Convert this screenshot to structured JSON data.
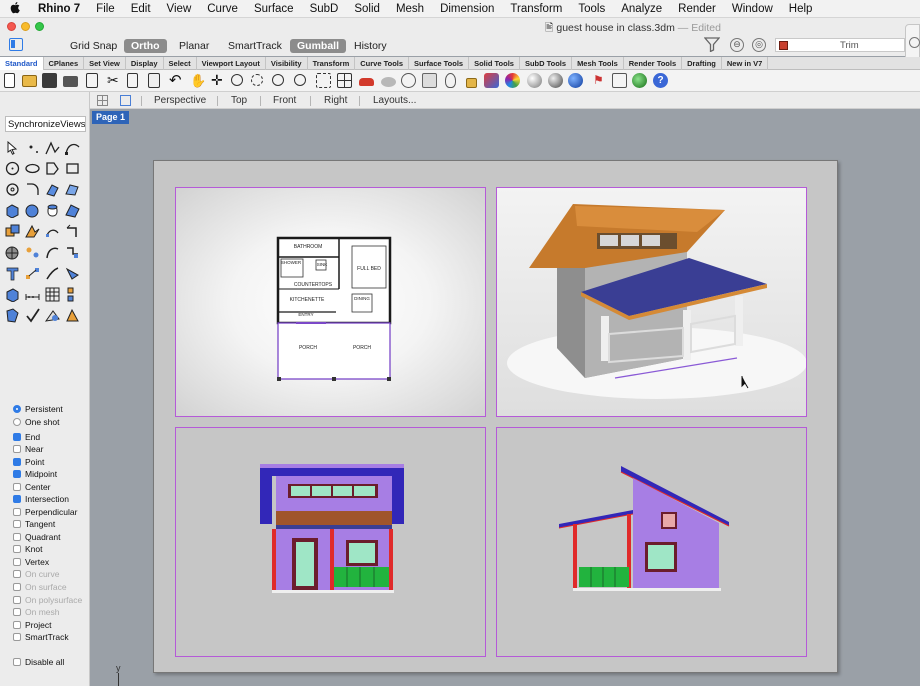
{
  "menu": {
    "apple": "",
    "app": "Rhino 7",
    "items": [
      "File",
      "Edit",
      "View",
      "Curve",
      "Surface",
      "SubD",
      "Solid",
      "Mesh",
      "Dimension",
      "Transform",
      "Tools",
      "Analyze",
      "Render",
      "Window",
      "Help"
    ]
  },
  "window": {
    "title": "guest house in class.3dm",
    "status": "— Edited"
  },
  "status_bar": {
    "items": [
      {
        "label": "Grid Snap",
        "on": false
      },
      {
        "label": "Ortho",
        "on": true
      },
      {
        "label": "Planar",
        "on": false
      },
      {
        "label": "SmartTrack",
        "on": false
      },
      {
        "label": "Gumball",
        "on": true
      },
      {
        "label": "History",
        "on": false
      }
    ],
    "layer": "Trim",
    "layer_color": "#c8402e"
  },
  "tabs": [
    "Standard",
    "CPlanes",
    "Set View",
    "Display",
    "Select",
    "Viewport Layout",
    "Visibility",
    "Transform",
    "Curve Tools",
    "Surface Tools",
    "Solid Tools",
    "SubD Tools",
    "Mesh Tools",
    "Render Tools",
    "Drafting",
    "New in V7"
  ],
  "active_tab": "Standard",
  "viewport_tabs": [
    "Perspective",
    "Top",
    "Front",
    "Right",
    "Layouts..."
  ],
  "command": {
    "value": "SynchronizeViews"
  },
  "page_tab": "Page 1",
  "osnap": {
    "mode": [
      {
        "label": "Persistent",
        "selected": true
      },
      {
        "label": "One shot",
        "selected": false
      }
    ],
    "items": [
      {
        "label": "End",
        "checked": true,
        "enabled": true
      },
      {
        "label": "Near",
        "checked": false,
        "enabled": true
      },
      {
        "label": "Point",
        "checked": true,
        "enabled": true
      },
      {
        "label": "Midpoint",
        "checked": true,
        "enabled": true
      },
      {
        "label": "Center",
        "checked": false,
        "enabled": true
      },
      {
        "label": "Intersection",
        "checked": true,
        "enabled": true
      },
      {
        "label": "Perpendicular",
        "checked": false,
        "enabled": true
      },
      {
        "label": "Tangent",
        "checked": false,
        "enabled": true
      },
      {
        "label": "Quadrant",
        "checked": false,
        "enabled": true
      },
      {
        "label": "Knot",
        "checked": false,
        "enabled": true
      },
      {
        "label": "Vertex",
        "checked": false,
        "enabled": true
      },
      {
        "label": "On curve",
        "checked": false,
        "enabled": false
      },
      {
        "label": "On surface",
        "checked": false,
        "enabled": false
      },
      {
        "label": "On polysurface",
        "checked": false,
        "enabled": false
      },
      {
        "label": "On mesh",
        "checked": false,
        "enabled": false
      },
      {
        "label": "Project",
        "checked": false,
        "enabled": true
      },
      {
        "label": "SmartTrack",
        "checked": false,
        "enabled": true
      }
    ],
    "disable_all": "Disable all"
  },
  "plan_labels": {
    "bathroom": "BATHROOM",
    "shower": "SHOWER",
    "sink": "SINK",
    "full_bed": "FULL BED",
    "countertops": "COUNTERTOPS",
    "kitchenette": "KITCHENETTE",
    "dining": "DINING",
    "entry": "ENTRY",
    "porch_left": "PORCH",
    "porch_right": "PORCH"
  },
  "axis_label": "y",
  "colors": {
    "detail_border": "#b55ad8",
    "wall_purple": "#a77ee4",
    "roof_blue": "#3227b8",
    "window_green": "#9fe6c6",
    "rail_green": "#22b33e",
    "trim_red": "#e02a2a",
    "trim_brown": "#a0552b"
  }
}
